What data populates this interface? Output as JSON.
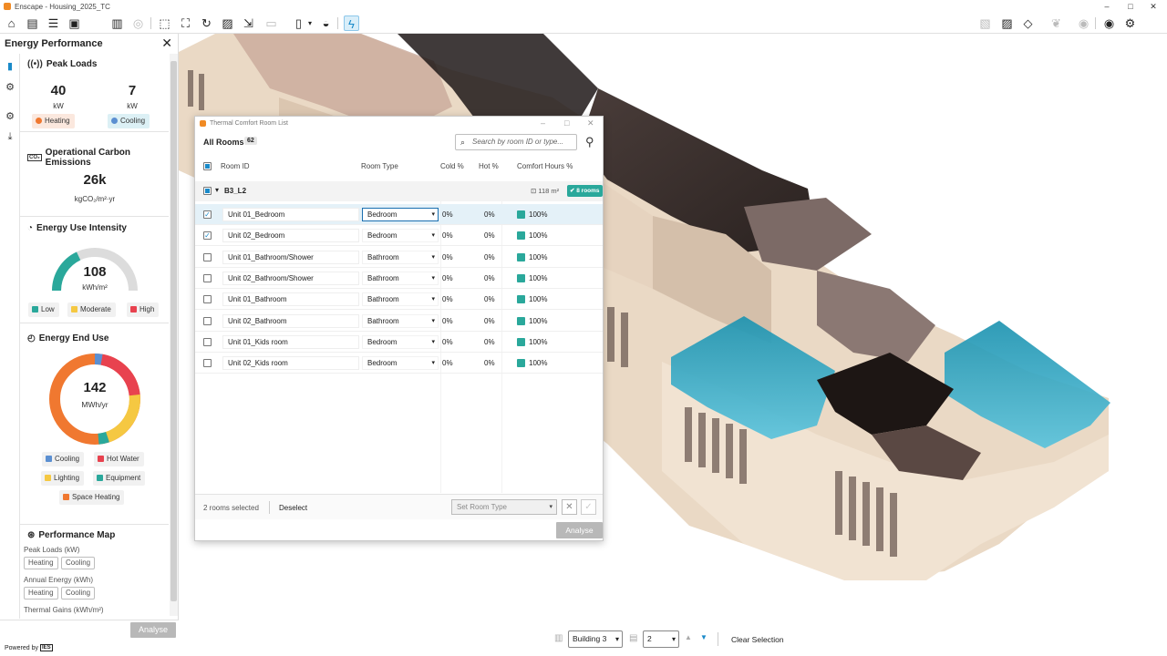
{
  "app": {
    "title": "Enscape - Housing_2025_TC"
  },
  "toolbar": {
    "icons": [
      "home-icon",
      "document-icon",
      "list-icon",
      "safe-icon",
      "buildings-icon",
      "globe-icon",
      "cursor-icon",
      "scan-icon",
      "refresh-icon",
      "image-icon",
      "vr-icon",
      "file-export-icon",
      "chevron-down-icon",
      "eye-scan-icon",
      "energy-icon",
      "camera-icon",
      "picture-icon",
      "cube-icon",
      "leaf-icon",
      "settings-icon",
      "eye-icon",
      "gears-icon"
    ]
  },
  "left_panel": {
    "title": "Energy Performance",
    "peak_loads": {
      "title": "Peak Loads",
      "heating_value": "40",
      "heating_unit": "kW",
      "heating_label": "Heating",
      "cooling_value": "7",
      "cooling_unit": "kW",
      "cooling_label": "Cooling"
    },
    "carbon": {
      "title": "Operational Carbon Emissions",
      "value": "26k",
      "unit": "kgCO₂/m²·yr"
    },
    "eui": {
      "title": "Energy Use Intensity",
      "value": "108",
      "unit": "kWh/m²",
      "gauge_fraction": 0.36,
      "low": "Low",
      "moderate": "Moderate",
      "high": "High",
      "colors": {
        "low": "#2aa89b",
        "moderate": "#f5c842",
        "high": "#e8424f",
        "track": "#dcdcdc"
      }
    },
    "end_use": {
      "title": "Energy End Use",
      "value": "142",
      "unit": "MWh/yr",
      "legend": {
        "cooling": "Cooling",
        "hot_water": "Hot Water",
        "lighting": "Lighting",
        "equipment": "Equipment",
        "space_heating": "Space Heating"
      },
      "colors": {
        "cooling": "#5b8fd1",
        "hot_water": "#e8424f",
        "lighting": "#f5c842",
        "equipment": "#2aa89b",
        "space_heating": "#f07830"
      }
    },
    "perf_map": {
      "title": "Performance Map",
      "peak_loads_label": "Peak Loads (kW)",
      "annual_energy_label": "Annual Energy (kWh)",
      "thermal_gains_label": "Thermal Gains (kWh/m²)",
      "heating": "Heating",
      "cooling": "Cooling"
    },
    "analyse": "Analyse",
    "powered_by": "Powered by",
    "ies": "IES"
  },
  "dialog": {
    "title": "Thermal Comfort Room List",
    "all_rooms": "All Rooms",
    "room_count": "62",
    "search_placeholder": "Search by room ID or type...",
    "columns": {
      "room_id": "Room ID",
      "room_type": "Room Type",
      "cold": "Cold %",
      "hot": "Hot %",
      "comfort": "Comfort Hours %"
    },
    "group": {
      "name": "B3_L2",
      "area": "118 m²",
      "badge": "8 rooms"
    },
    "rows": [
      {
        "id": "Unit 01_Bedroom",
        "type": "Bedroom",
        "cold": "0%",
        "hot": "0%",
        "comfort": "100%",
        "checked": true
      },
      {
        "id": "Unit 02_Bedroom",
        "type": "Bedroom",
        "cold": "0%",
        "hot": "0%",
        "comfort": "100%",
        "checked": true
      },
      {
        "id": "Unit 01_Bathroom/Shower",
        "type": "Bathroom",
        "cold": "0%",
        "hot": "0%",
        "comfort": "100%",
        "checked": false
      },
      {
        "id": "Unit 02_Bathroom/Shower",
        "type": "Bathroom",
        "cold": "0%",
        "hot": "0%",
        "comfort": "100%",
        "checked": false
      },
      {
        "id": "Unit 01_Bathroom",
        "type": "Bathroom",
        "cold": "0%",
        "hot": "0%",
        "comfort": "100%",
        "checked": false
      },
      {
        "id": "Unit 02_Bathroom",
        "type": "Bathroom",
        "cold": "0%",
        "hot": "0%",
        "comfort": "100%",
        "checked": false
      },
      {
        "id": "Unit 01_Kids room",
        "type": "Bedroom",
        "cold": "0%",
        "hot": "0%",
        "comfort": "100%",
        "checked": false
      },
      {
        "id": "Unit 02_Kids room",
        "type": "Bedroom",
        "cold": "0%",
        "hot": "0%",
        "comfort": "100%",
        "checked": false
      }
    ],
    "selected_text": "2 rooms selected",
    "deselect": "Deselect",
    "set_room_type_placeholder": "Set Room Type",
    "analyse": "Analyse",
    "accent": "#2aa89b"
  },
  "bottom_bar": {
    "building": "Building 3",
    "level": "2",
    "clear_selection": "Clear Selection"
  }
}
